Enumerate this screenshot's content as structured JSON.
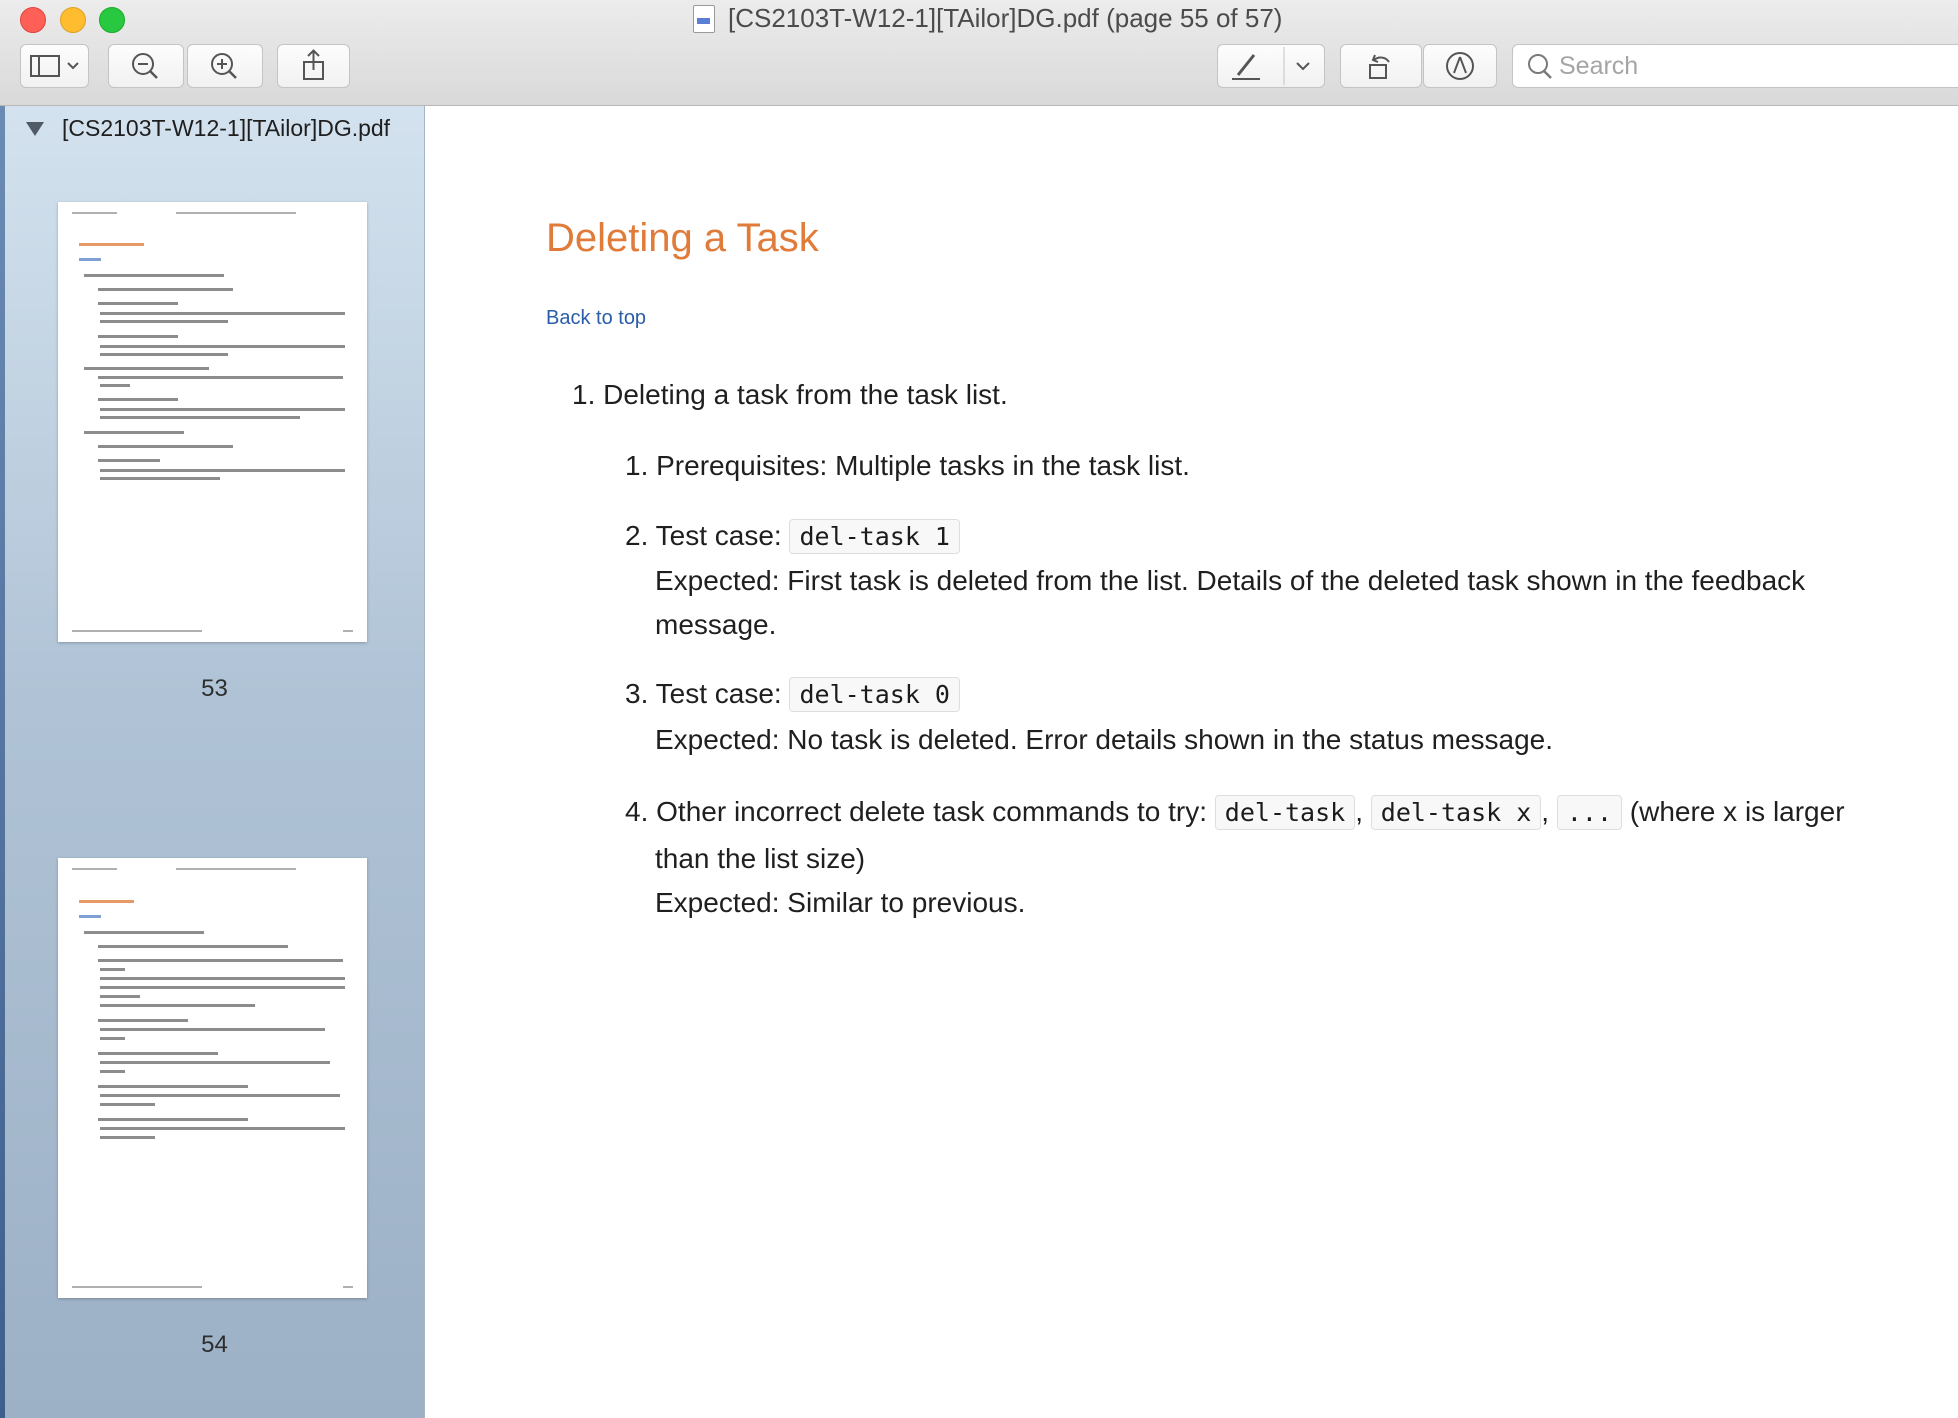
{
  "window": {
    "title": "[CS2103T-W12-1][TAilor]DG.pdf (page 55 of 57)"
  },
  "toolbar": {
    "search_placeholder": "Search",
    "icons": [
      "sidebar-toggle-icon",
      "zoom-out-icon",
      "zoom-in-icon",
      "share-icon",
      "markup-pen-icon",
      "chevron-down-icon",
      "rotate-icon",
      "annotate-icon",
      "search-icon"
    ]
  },
  "sidebar": {
    "file_name": "[CS2103T-W12-1][TAilor]DG.pdf",
    "thumbnails": [
      {
        "page": "53"
      },
      {
        "page": "54"
      }
    ]
  },
  "document": {
    "heading": "Deleting a Task",
    "back_link": "Back to top",
    "main_item": "1. Deleting a task from the task list.",
    "sub1": "1. Prerequisites: Multiple tasks in the task list.",
    "sub2_prefix": "2. Test case:",
    "sub2_code": "del-task 1",
    "sub2_expected_1": "Expected: First task is deleted from the list. Details of the deleted task shown in the feedback",
    "sub2_expected_2": "message.",
    "sub3_prefix": "3. Test case:",
    "sub3_code": "del-task 0",
    "sub3_expected": "Expected: No task is deleted. Error details shown in the status message.",
    "sub4_prefix": "4. Other incorrect delete task commands to try:",
    "sub4_code1": "del-task",
    "sub4_sep1": ",",
    "sub4_code2": "del-task x",
    "sub4_sep2": ",",
    "sub4_code3": "...",
    "sub4_suffix": "(where x is larger",
    "sub4_line2": "than the list size)",
    "sub4_expected": "Expected: Similar to previous."
  },
  "colors": {
    "heading": "#e07b39",
    "link": "#2a5da8"
  }
}
